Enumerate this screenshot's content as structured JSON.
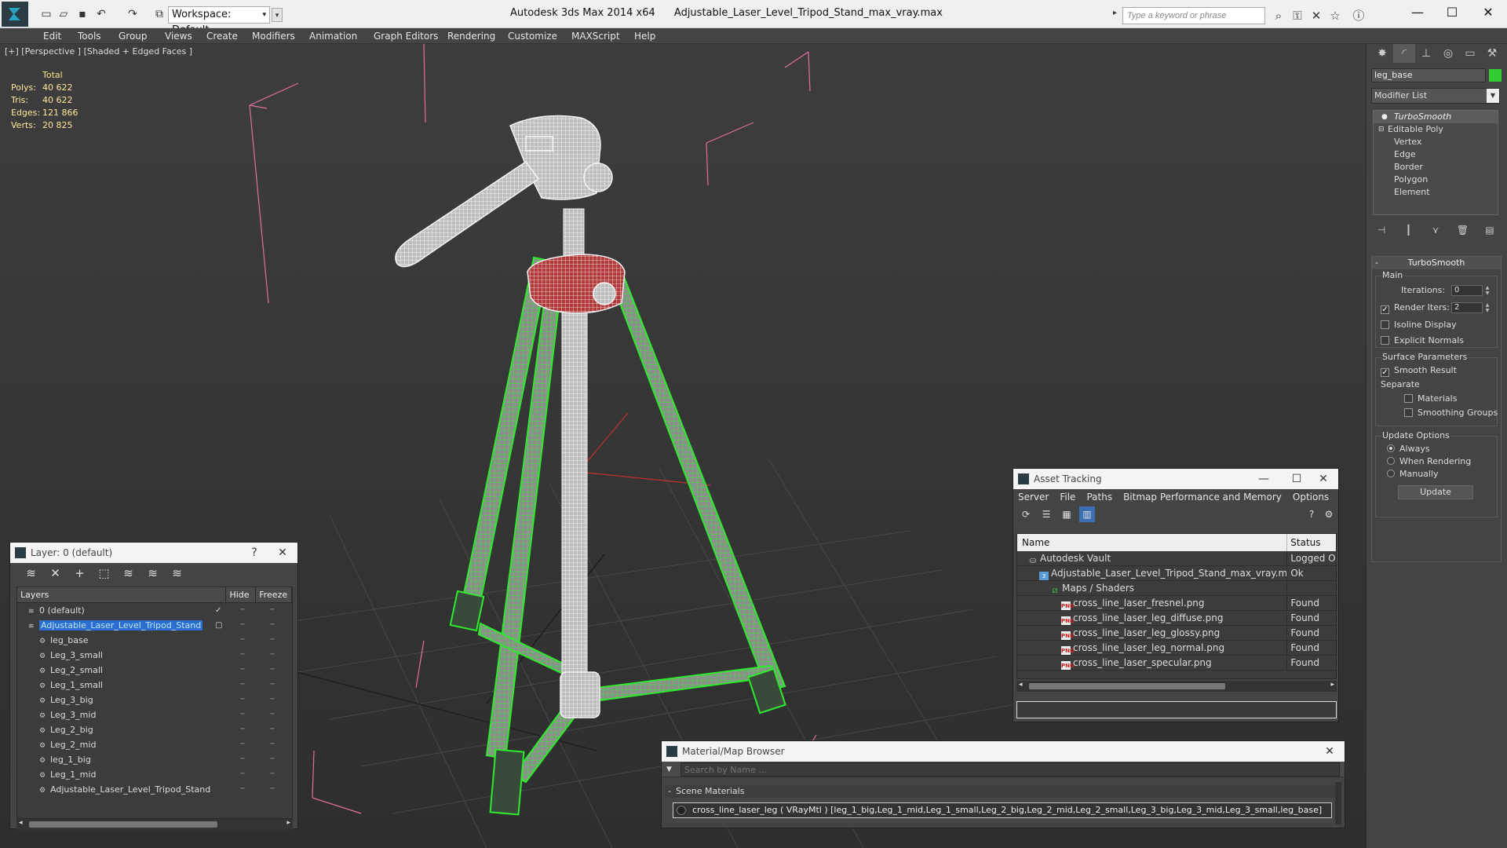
{
  "titlebar": {
    "workspace": "Workspace: Default",
    "app_name": "Autodesk 3ds Max  2014 x64",
    "file_name": "Adjustable_Laser_Level_Tripod_Stand_max_vray.max",
    "search_placeholder": "Type a keyword or phrase"
  },
  "menu": [
    "Edit",
    "Tools",
    "Group",
    "Views",
    "Create",
    "Modifiers",
    "Animation",
    "Graph Editors",
    "Rendering",
    "Customize",
    "MAXScript",
    "Help"
  ],
  "viewport": {
    "label": "[+] [Perspective ] [Shaded + Edged Faces ]",
    "stats": {
      "header": "Total",
      "rows": [
        {
          "k": "Polys:",
          "v": "40 622"
        },
        {
          "k": "Tris:",
          "v": "40 622"
        },
        {
          "k": "Edges:",
          "v": "121 866"
        },
        {
          "k": "Verts:",
          "v": "20 825"
        }
      ]
    },
    "colors": {
      "background": "#3a3a3a",
      "wire": "#2eea2e",
      "bbox": "#e06fa0",
      "grid": "#4a4a4a"
    }
  },
  "command_panel": {
    "object_name": "leg_base",
    "object_color": "#33cc33",
    "modifier_list": "Modifier List",
    "stack": [
      "TurboSmooth",
      "Editable Poly",
      "Vertex",
      "Edge",
      "Border",
      "Polygon",
      "Element"
    ],
    "rollout_title": "TurboSmooth",
    "main_group": "Main",
    "iterations_label": "Iterations:",
    "iterations_value": "0",
    "render_iters_label": "Render Iters:",
    "render_iters_value": "2",
    "isoline": "Isoline Display",
    "explicit_normals": "Explicit Normals",
    "surface_group": "Surface Parameters",
    "smooth_result": "Smooth Result",
    "separate": "Separate",
    "materials": "Materials",
    "smoothing_groups": "Smoothing Groups",
    "update_group": "Update Options",
    "always": "Always",
    "when_rendering": "When Rendering",
    "manually": "Manually",
    "update_button": "Update"
  },
  "layer_dialog": {
    "title": "Layer: 0 (default)",
    "help": "?",
    "col_layers": "Layers",
    "col_hide": "Hide",
    "col_freeze": "Freeze",
    "rows": [
      {
        "name": "0 (default)",
        "indent": 0,
        "selected": false,
        "check": "✓"
      },
      {
        "name": "Adjustable_Laser_Level_Tripod_Stand",
        "indent": 0,
        "selected": true,
        "check": "▢"
      },
      {
        "name": "leg_base",
        "indent": 1,
        "selected": false,
        "check": ""
      },
      {
        "name": "Leg_3_small",
        "indent": 1,
        "selected": false,
        "check": ""
      },
      {
        "name": "Leg_2_small",
        "indent": 1,
        "selected": false,
        "check": ""
      },
      {
        "name": "Leg_1_small",
        "indent": 1,
        "selected": false,
        "check": ""
      },
      {
        "name": "Leg_3_big",
        "indent": 1,
        "selected": false,
        "check": ""
      },
      {
        "name": "Leg_3_mid",
        "indent": 1,
        "selected": false,
        "check": ""
      },
      {
        "name": "Leg_2_big",
        "indent": 1,
        "selected": false,
        "check": ""
      },
      {
        "name": "Leg_2_mid",
        "indent": 1,
        "selected": false,
        "check": ""
      },
      {
        "name": "leg_1_big",
        "indent": 1,
        "selected": false,
        "check": ""
      },
      {
        "name": "Leg_1_mid",
        "indent": 1,
        "selected": false,
        "check": ""
      },
      {
        "name": "Adjustable_Laser_Level_Tripod_Stand",
        "indent": 1,
        "selected": false,
        "check": ""
      }
    ]
  },
  "asset_dialog": {
    "title": "Asset Tracking",
    "menu": [
      "Server",
      "File",
      "Paths",
      "Bitmap Performance and Memory",
      "Options"
    ],
    "col_name": "Name",
    "col_status": "Status",
    "rows": [
      {
        "name": "Autodesk Vault",
        "status": "Logged Out",
        "indent": 1,
        "icon": "vault"
      },
      {
        "name": "Adjustable_Laser_Level_Tripod_Stand_max_vray.max",
        "status": "Ok",
        "indent": 2,
        "icon": "max"
      },
      {
        "name": "Maps / Shaders",
        "status": "",
        "indent": 3,
        "icon": "maps"
      },
      {
        "name": "cross_line_laser_fresnel.png",
        "status": "Found",
        "indent": 4,
        "icon": "png"
      },
      {
        "name": "cross_line_laser_leg_diffuse.png",
        "status": "Found",
        "indent": 4,
        "icon": "png"
      },
      {
        "name": "cross_line_laser_leg_glossy.png",
        "status": "Found",
        "indent": 4,
        "icon": "png"
      },
      {
        "name": "cross_line_laser_leg_normal.png",
        "status": "Found",
        "indent": 4,
        "icon": "png"
      },
      {
        "name": "cross_line_laser_specular.png",
        "status": "Found",
        "indent": 4,
        "icon": "png"
      }
    ]
  },
  "material_dialog": {
    "title": "Material/Map Browser",
    "search_placeholder": "Search by Name ...",
    "group": "Scene Materials",
    "entry": "cross_line_laser_leg  ( VRayMtl ) [leg_1_big,Leg_1_mid,Leg_1_small,Leg_2_big,Leg_2_mid,Leg_2_small,Leg_3_big,Leg_3_mid,Leg_3_small,leg_base]"
  }
}
